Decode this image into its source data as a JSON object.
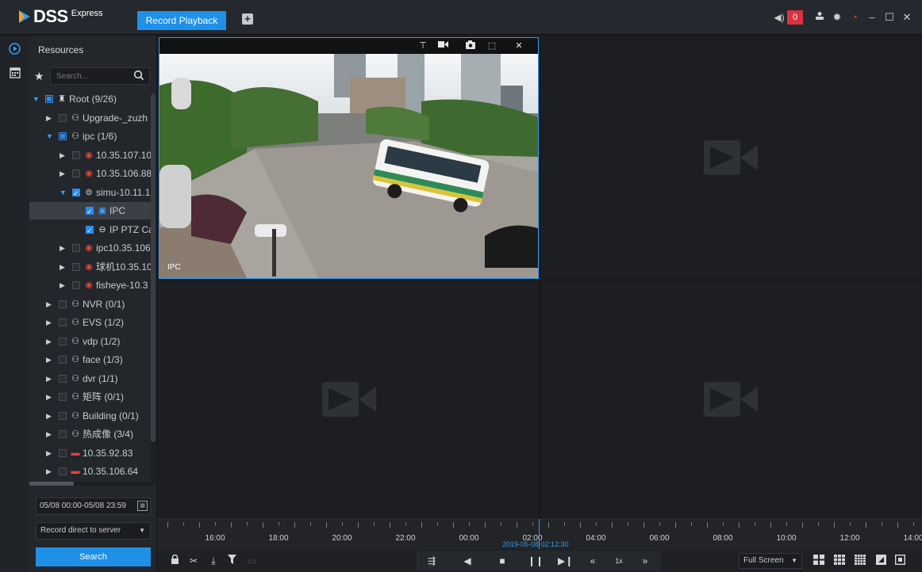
{
  "app": {
    "brand": "DSS",
    "edition": "Express"
  },
  "tabs": {
    "active": "Record Playback",
    "add": "+"
  },
  "top_right": {
    "alarm_count": "0"
  },
  "panel": {
    "title": "Resources",
    "search_placeholder": "Search..."
  },
  "tree": [
    {
      "label": "Root (9/26)",
      "level": 0,
      "expanded": true,
      "check": "part",
      "icon": "root-icon"
    },
    {
      "label": "Upgrade-_zuzh",
      "level": 1,
      "expanded": false,
      "check": "none",
      "icon": "org-icon"
    },
    {
      "label": "ipc (1/6)",
      "level": 1,
      "expanded": true,
      "check": "part",
      "icon": "org-icon"
    },
    {
      "label": "10.35.107.10",
      "level": 2,
      "expanded": false,
      "check": "none",
      "icon": "camera-device-icon"
    },
    {
      "label": "10.35.106.88",
      "level": 2,
      "expanded": false,
      "check": "none",
      "icon": "camera-device-icon"
    },
    {
      "label": "simu-10.11.1",
      "level": 2,
      "expanded": true,
      "check": "full",
      "icon": "nvr-device-icon"
    },
    {
      "label": "IPC",
      "level": 3,
      "expanded": null,
      "check": "full",
      "icon": "channel-icon",
      "selected": true
    },
    {
      "label": "IP PTZ Ca",
      "level": 3,
      "expanded": null,
      "check": "full",
      "icon": "ptz-icon"
    },
    {
      "label": "ipc10.35.106",
      "level": 2,
      "expanded": false,
      "check": "none",
      "icon": "camera-device-icon"
    },
    {
      "label": "球机10.35.10",
      "level": 2,
      "expanded": false,
      "check": "none",
      "icon": "camera-device-icon"
    },
    {
      "label": "fisheye-10.3",
      "level": 2,
      "expanded": false,
      "check": "none",
      "icon": "camera-device-icon"
    },
    {
      "label": "NVR (0/1)",
      "level": 1,
      "expanded": false,
      "check": "none",
      "icon": "org-icon"
    },
    {
      "label": "EVS (1/2)",
      "level": 1,
      "expanded": false,
      "check": "none",
      "icon": "org-icon"
    },
    {
      "label": "vdp (1/2)",
      "level": 1,
      "expanded": false,
      "check": "none",
      "icon": "org-icon"
    },
    {
      "label": "face (1/3)",
      "level": 1,
      "expanded": false,
      "check": "none",
      "icon": "org-icon"
    },
    {
      "label": "dvr (1/1)",
      "level": 1,
      "expanded": false,
      "check": "none",
      "icon": "org-icon"
    },
    {
      "label": "矩阵 (0/1)",
      "level": 1,
      "expanded": false,
      "check": "none",
      "icon": "org-icon"
    },
    {
      "label": "Building (0/1)",
      "level": 1,
      "expanded": false,
      "check": "none",
      "icon": "org-icon"
    },
    {
      "label": "热成像 (3/4)",
      "level": 1,
      "expanded": false,
      "check": "none",
      "icon": "org-icon"
    },
    {
      "label": "10.35.92.83",
      "level": 1,
      "expanded": false,
      "check": "none",
      "icon": "recorder-icon"
    },
    {
      "label": "10.35.106.64",
      "level": 1,
      "expanded": false,
      "check": "none",
      "icon": "recorder-icon"
    }
  ],
  "filters": {
    "date_range": "05/08 00:00-05/08 23:59",
    "record_source": "Record direct to server",
    "search_button": "Search"
  },
  "video": {
    "channel_label": "IPC",
    "osd_time": "2019-05-08 02:12:30"
  },
  "timeline": {
    "labels": [
      "16:00",
      "18:00",
      "20:00",
      "22:00",
      "00:00",
      "02:00",
      "04:00",
      "06:00",
      "08:00",
      "10:00",
      "12:00",
      "14:00"
    ],
    "current_time": "2019-05-08 02:12:30"
  },
  "controls": {
    "speed": "1x",
    "fullscreen": "Full Screen"
  },
  "colors": {
    "accent": "#1e90e8",
    "alarm": "#d9333f"
  }
}
